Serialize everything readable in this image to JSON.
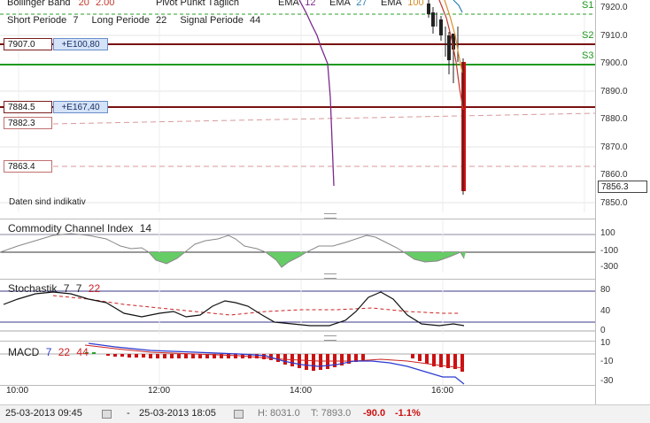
{
  "top_legend": {
    "bollinger_label": "Bollinger Band",
    "bollinger_p1": "20",
    "bollinger_p2": "2.00",
    "pivot_label": "Pivot Punkt Täglich",
    "ema1_label": "EMA",
    "ema1_val": "12",
    "ema2_label": "EMA",
    "ema2_val": "27",
    "ema3_label": "EMA",
    "ema3_val": "100",
    "short_label": "Short Periode",
    "short_val": "7",
    "long_label": "Long Periode",
    "long_val": "22",
    "signal_label": "Signal Periode",
    "signal_val": "44"
  },
  "price_boxes": [
    {
      "label": "7907.0",
      "order": "+E100,80"
    },
    {
      "label": "7884.5",
      "order": "+E167,40"
    },
    {
      "label": "7882.3"
    },
    {
      "label": "7863.4"
    }
  ],
  "pivot_labels": [
    "S1",
    "S2",
    "S3"
  ],
  "price_axis": [
    "7920.0",
    "7910.0",
    "7900.0",
    "7890.0",
    "7880.0",
    "7870.0",
    "7860.0",
    "7850.0"
  ],
  "current_price": "7856.3",
  "disclaimer": "Daten sind indikativ",
  "cci": {
    "title": "Commodity Channel Index",
    "period": "14",
    "axis": [
      "100",
      "-100",
      "-300"
    ]
  },
  "stochastic": {
    "title": "Stochastik",
    "p1": "7",
    "p2": "7",
    "p3": "22",
    "axis": [
      "80",
      "40",
      "0"
    ]
  },
  "macd": {
    "title": "MACD",
    "p1": "7",
    "p2": "22",
    "p3": "44",
    "axis": [
      "10",
      "-10",
      "-30"
    ]
  },
  "time_axis": [
    "10:00",
    "12:00",
    "14:00",
    "16:00"
  ],
  "footer": {
    "from": "25-03-2013 09:45",
    "dash": "-",
    "to": "25-03-2013 18:05",
    "high": "H: 8031.0",
    "target": "T: 7893.0",
    "change": "-90.0",
    "change_pct": "-1.1%"
  },
  "colors": {
    "bollinger": "#c0392b",
    "ema12": "#7b2a8c",
    "ema27": "#2e7fb0",
    "pivot": "#1e9a1e",
    "order_line": "#7a1010",
    "negative": "#cc1111"
  }
}
